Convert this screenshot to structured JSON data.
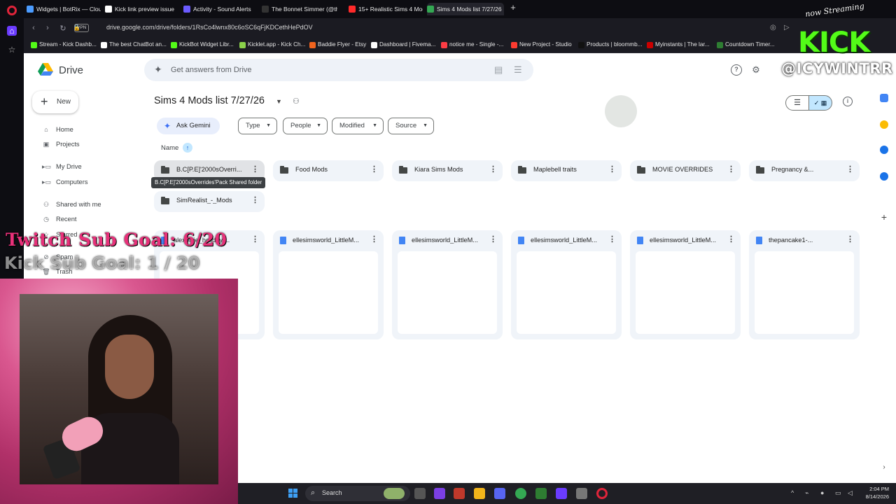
{
  "browser": {
    "tabs": [
      {
        "label": "Widgets | BotRix — Cloud",
        "color": "#4b9cff"
      },
      {
        "label": "Kick link preview issue",
        "color": "#ffffff"
      },
      {
        "label": "Activity - Sound Alerts",
        "color": "#6b5bff"
      },
      {
        "label": "The Bonnet Simmer (@th",
        "color": "#111111"
      },
      {
        "label": "15+ Realistic Sims 4 Mod",
        "color": "#ff2a2a"
      },
      {
        "label": "Sims 4 Mods list 7/27/26",
        "color": "#34a853"
      }
    ],
    "url": "drive.google.com/drive/folders/1RsCo4lwnx80c6oSC6qFjKDCethHePdOV",
    "vpn_label": "VPN",
    "bookmarks": [
      {
        "label": "Stream - Kick Dashb...",
        "color": "#53fc18"
      },
      {
        "label": "The best ChatBot an...",
        "color": "#ffffff"
      },
      {
        "label": "KickBot Widget Libr...",
        "color": "#53fc18"
      },
      {
        "label": "Kicklet.app - Kick Ch...",
        "color": "#8bd14a"
      },
      {
        "label": "Baddie Flyer - Etsy",
        "color": "#f1641e"
      },
      {
        "label": "Dashboard | Fivema...",
        "color": "#ffffff"
      },
      {
        "label": "notice me - Single -...",
        "color": "#fc3c44"
      },
      {
        "label": "New Project - Studio",
        "color": "#ff3b30"
      },
      {
        "label": "Products | bloommb...",
        "color": "#111111"
      },
      {
        "label": "Myinstants | The lar...",
        "color": "#cc0000"
      },
      {
        "label": "Countdown Timer...",
        "color": "#2e7d32"
      }
    ]
  },
  "drive": {
    "app_title": "Drive",
    "search_placeholder": "Get answers from Drive",
    "new_label": "New",
    "nav": [
      {
        "label": "Home",
        "icon": "home-icon"
      },
      {
        "label": "Projects",
        "icon": "projects-icon"
      },
      {
        "label": "My Drive",
        "icon": "drive-icon"
      },
      {
        "label": "Computers",
        "icon": "computer-icon"
      },
      {
        "label": "Shared with me",
        "icon": "people-icon"
      },
      {
        "label": "Recent",
        "icon": "clock-icon"
      },
      {
        "label": "Starred",
        "icon": "star-icon"
      },
      {
        "label": "Spam",
        "icon": "spam-icon"
      },
      {
        "label": "Trash",
        "icon": "trash-icon"
      }
    ],
    "folder_title": "Sims 4 Mods list 7/27/26",
    "ask_gemini": "Ask Gemini",
    "filters": [
      "Type",
      "People",
      "Modified",
      "Source"
    ],
    "sort_label": "Name",
    "folders": [
      "B.C[P.E]'2000sOverri...",
      "Food Mods",
      "Kiara Sims Mods",
      "Maplebell traits",
      "MOVIE OVERRIDES",
      "Pregnancy &...",
      "SimRealist_-_Mods"
    ],
    "tooltip": "B.C[P.E]'2000sOverrides'Pack Shared folder",
    "files": [
      "alexpixie_holidayt...",
      "ellesimsworld_LittleM...",
      "ellesimsworld_LittleM...",
      "ellesimsworld_LittleM...",
      "ellesimsworld_LittleM...",
      "thepancake1-..."
    ]
  },
  "taskbar": {
    "search_label": "Search",
    "time": "2:04 PM",
    "date": "8/14/2026"
  },
  "overlay": {
    "twitch_goal": "Twitch Sub Goal: 6/20",
    "kick_goal": "Kick Sub Goal: 1 / 20",
    "now_streaming": "now Streaming",
    "kick_logo": "KICK",
    "handle": "@ICYWINTRR"
  }
}
